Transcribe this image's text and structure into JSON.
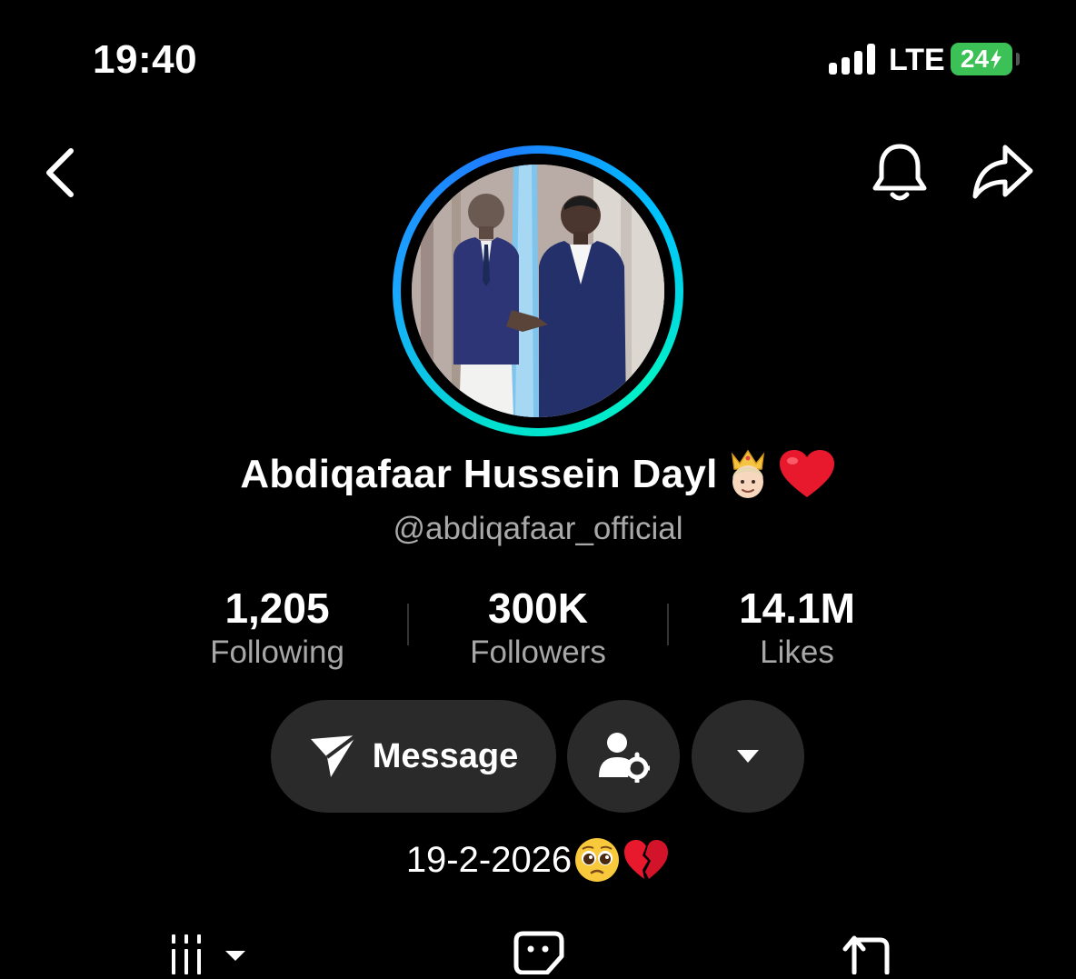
{
  "status_bar": {
    "time": "19:40",
    "network": "LTE",
    "battery": "24"
  },
  "nav": {
    "back_icon": "chevron-left-icon",
    "notifications_icon": "bell-icon",
    "share_icon": "share-arrow-icon"
  },
  "profile": {
    "name": "Abdiqafaar Hussein Dayl",
    "name_emojis": [
      "prince-emoji",
      "red-heart-emoji"
    ],
    "handle": "@abdiqafaar_official",
    "bio_text": "19-2-2026",
    "bio_emojis": [
      "pleading-face-emoji",
      "broken-heart-emoji"
    ]
  },
  "stats": {
    "following": {
      "value": "1,205",
      "label": "Following"
    },
    "followers": {
      "value": "300K",
      "label": "Followers"
    },
    "likes": {
      "value": "14.1M",
      "label": "Likes"
    }
  },
  "actions": {
    "message_label": "Message",
    "message_icon": "paper-plane-icon",
    "friend_settings_icon": "user-gear-icon",
    "more_icon": "caret-down-icon"
  },
  "tabs": [
    {
      "icon": "grid-videos-icon"
    },
    {
      "icon": "sticker-icon"
    },
    {
      "icon": "repost-icon"
    }
  ],
  "colors": {
    "background": "#000000",
    "button_bg": "#2a2a2a",
    "battery_green": "#3cc157",
    "ring_accent": "#1aa6ff",
    "secondary_text": "#a9a9a9"
  }
}
